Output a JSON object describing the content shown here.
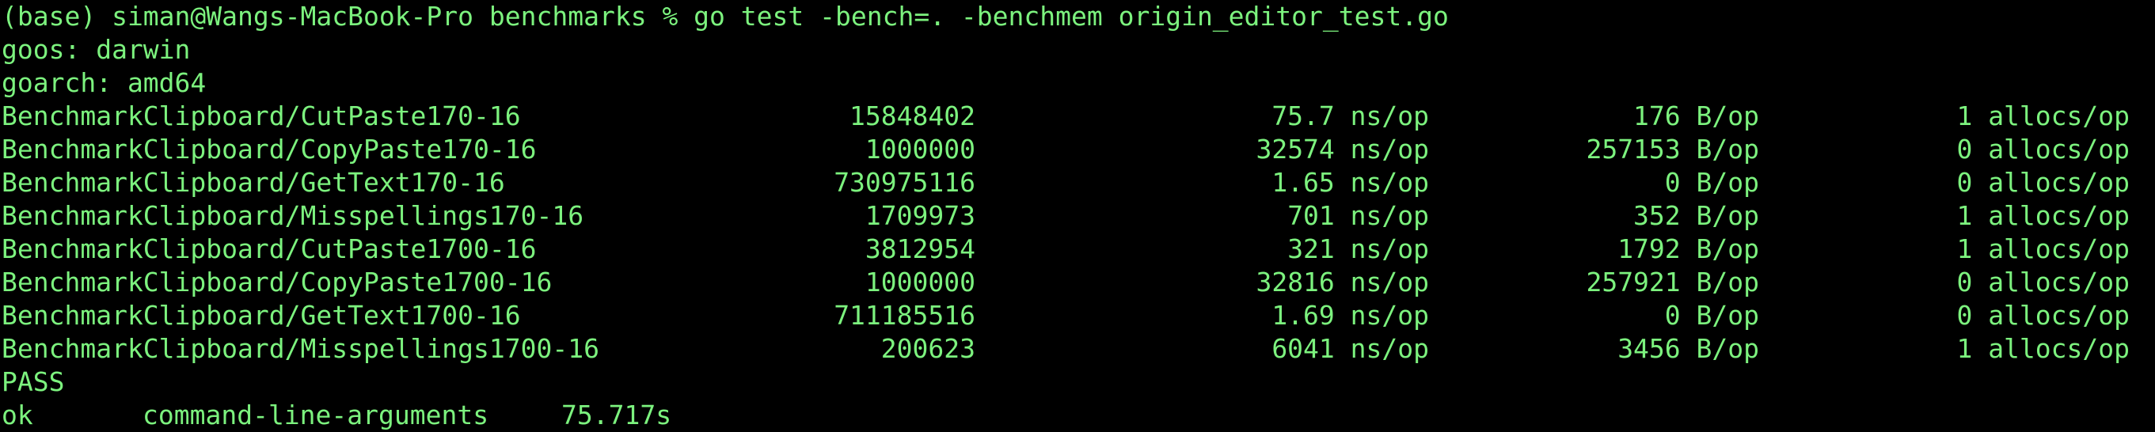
{
  "theme": {
    "background": "#000000",
    "foreground": "#7CF27E"
  },
  "command_line": "(base) siman@Wangs-MacBook-Pro benchmarks % go test -bench=. -benchmem origin_editor_test.go",
  "goos_line": "goos: darwin",
  "goarch_line": "goarch: amd64",
  "benchmarks": [
    {
      "name": "BenchmarkClipboard/CutPaste170-16",
      "iterations": "15848402",
      "ns": "75.7 ns/op",
      "bytes": "176 B/op",
      "allocs": "1 allocs/op"
    },
    {
      "name": "BenchmarkClipboard/CopyPaste170-16",
      "iterations": "1000000",
      "ns": "32574 ns/op",
      "bytes": "257153 B/op",
      "allocs": "0 allocs/op"
    },
    {
      "name": "BenchmarkClipboard/GetText170-16",
      "iterations": "730975116",
      "ns": "1.65 ns/op",
      "bytes": "0 B/op",
      "allocs": "0 allocs/op"
    },
    {
      "name": "BenchmarkClipboard/Misspellings170-16",
      "iterations": "1709973",
      "ns": "701 ns/op",
      "bytes": "352 B/op",
      "allocs": "1 allocs/op"
    },
    {
      "name": "BenchmarkClipboard/CutPaste1700-16",
      "iterations": "3812954",
      "ns": "321 ns/op",
      "bytes": "1792 B/op",
      "allocs": "1 allocs/op"
    },
    {
      "name": "BenchmarkClipboard/CopyPaste1700-16",
      "iterations": "1000000",
      "ns": "32816 ns/op",
      "bytes": "257921 B/op",
      "allocs": "0 allocs/op"
    },
    {
      "name": "BenchmarkClipboard/GetText1700-16",
      "iterations": "711185516",
      "ns": "1.69 ns/op",
      "bytes": "0 B/op",
      "allocs": "0 allocs/op"
    },
    {
      "name": "BenchmarkClipboard/Misspellings1700-16",
      "iterations": "200623",
      "ns": "6041 ns/op",
      "bytes": "3456 B/op",
      "allocs": "1 allocs/op"
    }
  ],
  "pass_line": "PASS",
  "result": {
    "status": "ok",
    "package": "command-line-arguments",
    "duration": "75.717s"
  }
}
